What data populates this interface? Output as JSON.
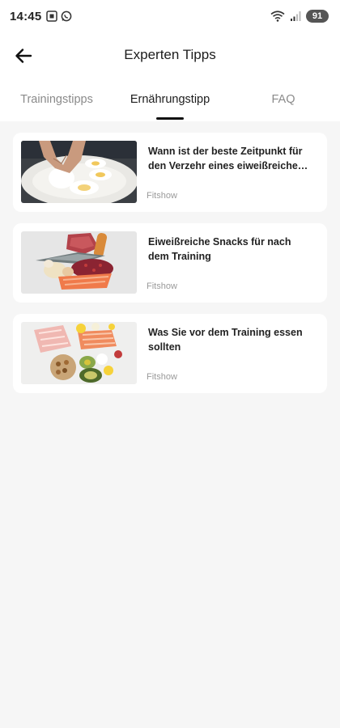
{
  "status": {
    "time": "14:45",
    "battery": "91"
  },
  "appbar": {
    "title": "Experten Tipps"
  },
  "tabs": [
    {
      "label": "Trainingstipps",
      "active": false
    },
    {
      "label": "Ernährungstipp",
      "active": true
    },
    {
      "label": "FAQ",
      "active": false
    }
  ],
  "articles": [
    {
      "title": "Wann ist der beste Zeitpunkt für den Verzehr eines eiweißreiche…",
      "source": "Fitshow",
      "image": "boiled-eggs-plate"
    },
    {
      "title": "Eiweißreiche Snacks für nach dem Training",
      "source": "Fitshow",
      "image": "protein-foods"
    },
    {
      "title": "Was Sie vor dem Training essen sollten",
      "source": "Fitshow",
      "image": "healthy-food-spread"
    }
  ],
  "colors": {
    "background": "#f6f6f6",
    "card": "#ffffff",
    "active_tab": "#1c1c1c",
    "inactive_tab": "#8a8a8a"
  }
}
